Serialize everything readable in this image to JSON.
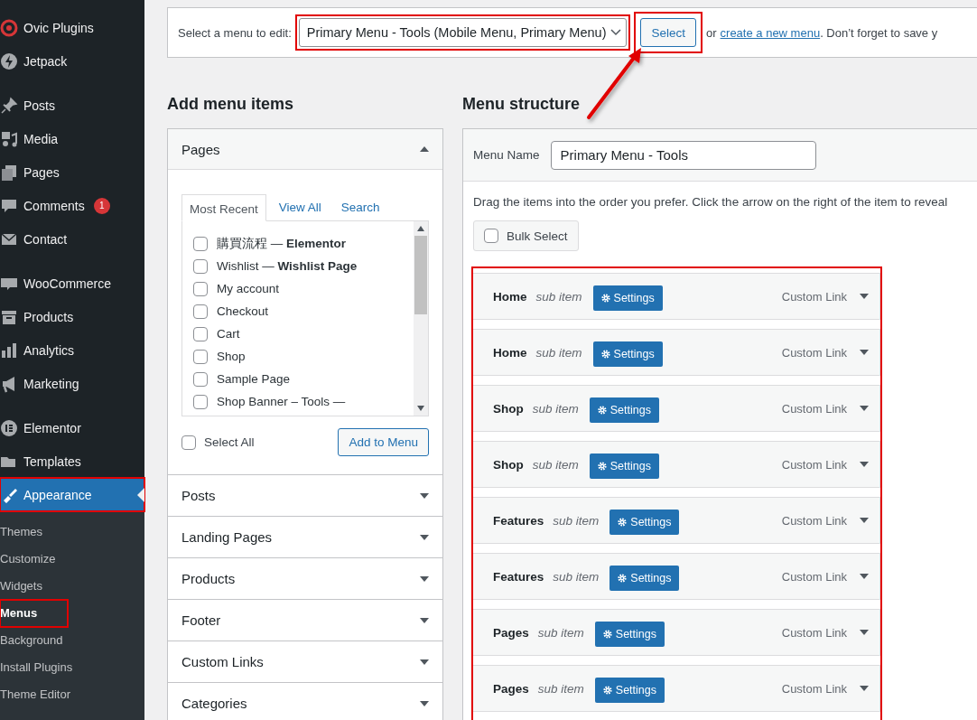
{
  "sidebar": {
    "groups": [
      [
        {
          "label": "Ovic Plugins",
          "current": false,
          "highlighted": false
        },
        {
          "label": "Jetpack",
          "current": false,
          "highlighted": false
        }
      ],
      [
        {
          "label": "Posts",
          "current": false,
          "highlighted": false
        },
        {
          "label": "Media",
          "current": false,
          "highlighted": false
        },
        {
          "label": "Pages",
          "current": false,
          "highlighted": false
        },
        {
          "label": "Comments",
          "badge": "1",
          "current": false,
          "highlighted": false
        },
        {
          "label": "Contact",
          "current": false,
          "highlighted": false
        }
      ],
      [
        {
          "label": "WooCommerce",
          "current": false,
          "highlighted": false
        },
        {
          "label": "Products",
          "current": false,
          "highlighted": false
        },
        {
          "label": "Analytics",
          "current": false,
          "highlighted": false
        },
        {
          "label": "Marketing",
          "current": false,
          "highlighted": false
        }
      ],
      [
        {
          "label": "Elementor",
          "current": false,
          "highlighted": false
        },
        {
          "label": "Templates",
          "current": false,
          "highlighted": false
        },
        {
          "label": "Appearance",
          "current": true,
          "highlighted": true
        }
      ]
    ],
    "submenu": [
      {
        "label": "Themes",
        "current": false,
        "highlighted": false
      },
      {
        "label": "Customize",
        "current": false,
        "highlighted": false
      },
      {
        "label": "Widgets",
        "current": false,
        "highlighted": false
      },
      {
        "label": "Menus",
        "current": true,
        "highlighted": true
      },
      {
        "label": "Background",
        "current": false,
        "highlighted": false
      },
      {
        "label": "Install Plugins",
        "current": false,
        "highlighted": false
      },
      {
        "label": "Theme Editor",
        "current": false,
        "highlighted": false
      }
    ]
  },
  "menu_picker": {
    "label": "Select a menu to edit:",
    "value": "Primary Menu - Tools (Mobile Menu, Primary Menu)",
    "highlighted": true,
    "button": {
      "label": "Select",
      "highlighted": true
    },
    "text_before_link": "or",
    "link": "create a new menu",
    "text_after_link": ". Don’t forget to save y"
  },
  "annotations": [
    {
      "kind": "arrow"
    }
  ],
  "add_menu_items": {
    "title": "Add menu items",
    "pages": {
      "title": "Pages",
      "expanded": true,
      "tabs": [
        {
          "label": "Most Recent",
          "selected": true
        },
        {
          "label": "View All",
          "selected": false
        },
        {
          "label": "Search",
          "selected": false
        }
      ],
      "items": [
        {
          "label": "購買流程 — **Elementor**",
          "checked": false
        },
        {
          "label": "Wishlist — **Wishlist Page**",
          "checked": false
        },
        {
          "label": "My account",
          "checked": false
        },
        {
          "label": "Checkout",
          "checked": false
        },
        {
          "label": "Cart",
          "checked": false
        },
        {
          "label": "Shop",
          "checked": false
        },
        {
          "label": "Sample Page",
          "checked": false
        },
        {
          "label": "Shop Banner – Tools —",
          "checked": false
        }
      ],
      "select_all": {
        "label": "Select All",
        "checked": false
      },
      "add_button": "Add to Menu"
    },
    "sections": [
      {
        "title": "Posts",
        "expanded": false
      },
      {
        "title": "Landing Pages",
        "expanded": false
      },
      {
        "title": "Products",
        "expanded": false
      },
      {
        "title": "Footer",
        "expanded": false
      },
      {
        "title": "Custom Links",
        "expanded": false
      },
      {
        "title": "Categories",
        "expanded": false
      }
    ]
  },
  "menu_structure": {
    "title": "Menu structure",
    "name_label": "Menu Name",
    "name_value": "Primary Menu - Tools",
    "instructions": "Drag the items into the order you prefer. Click the arrow on the right of the item to reveal",
    "bulk_select": {
      "label": "Bulk Select",
      "checked": false
    },
    "items_highlighted": true,
    "items": [
      {
        "title": "Home",
        "subtitle": "sub item",
        "button": "Settings",
        "type": "Custom Link"
      },
      {
        "title": "Home",
        "subtitle": "sub item",
        "button": "Settings",
        "type": "Custom Link"
      },
      {
        "title": "Shop",
        "subtitle": "sub item",
        "button": "Settings",
        "type": "Custom Link"
      },
      {
        "title": "Shop",
        "subtitle": "sub item",
        "button": "Settings",
        "type": "Custom Link"
      },
      {
        "title": "Features",
        "subtitle": "sub item",
        "button": "Settings",
        "type": "Custom Link"
      },
      {
        "title": "Features",
        "subtitle": "sub item",
        "button": "Settings",
        "type": "Custom Link"
      },
      {
        "title": "Pages",
        "subtitle": "sub item",
        "button": "Settings",
        "type": "Custom Link"
      },
      {
        "title": "Pages",
        "subtitle": "sub item",
        "button": "Settings",
        "type": "Custom Link"
      }
    ]
  }
}
